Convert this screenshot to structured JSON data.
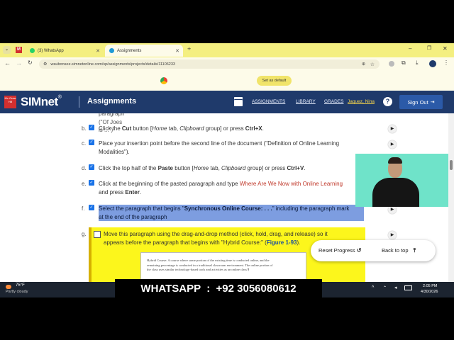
{
  "browser": {
    "tabs": [
      {
        "label": "(3) WhatsApp",
        "color": "#25d366"
      },
      {
        "label": "Assignments",
        "color": "#1f9ad6"
      }
    ],
    "new_tab": "+",
    "url": "waubonsee.simnetonline.com/sp/assignments/projects/details/11106233",
    "set_default": "Set as default"
  },
  "header": {
    "logo_brand": "Mc Graw Hill",
    "logo": "SIMnet",
    "reg": "®",
    "title": "Assignments",
    "nav": [
      "ASSIGNMENTS",
      "LIBRARY",
      "GRADES"
    ],
    "user": "Jaquez, Nina",
    "help": "?",
    "sign_out": "Sign Out"
  },
  "steps": {
    "partial": "paragraph (\"Of Joes is ...\")",
    "b": {
      "letter": "b.",
      "pre": "Click the ",
      "kw": "Cut",
      "mid": " button [",
      "em1": "Home",
      "mid2": " tab, ",
      "em2": "Clipboard",
      "post": " group] or press ",
      "key": "Ctrl+X",
      "end": "."
    },
    "c": {
      "letter": "c.",
      "line1": "Place your insertion point before the second line of the document (\"Definition of Online Learning",
      "line2": "Modalities\")."
    },
    "d": {
      "letter": "d.",
      "pre": "Click the top half of the ",
      "kw": "Paste",
      "mid": " button [",
      "em1": "Home",
      "mid2": " tab, ",
      "em2": "Clipboard",
      "post": " group] or press ",
      "key": "Ctrl+V",
      "end": "."
    },
    "e": {
      "letter": "e.",
      "line1_pre": "Click at the beginning of the pasted paragraph and type ",
      "line1_red": "Where Are We Now with Online Learning",
      "line2_pre": "and press ",
      "key": "Enter",
      "end": "."
    },
    "f": {
      "letter": "f.",
      "line1_pre": "Select the paragraph that begins \"",
      "kw": "Synchronous Online Course: . . .",
      "line1_post": "\" including the paragraph mark",
      "line2": "at the end of the paragraph"
    },
    "g": {
      "letter": "g.",
      "line1": "Move this paragraph using the drag-and-drop method (click, hold, drag, and release) so it",
      "line2_pre": "appears before the paragraph that begins with \"Hybrid Course:\" (",
      "fig": "Figure 1-93",
      "line2_post": ")."
    }
  },
  "figure_snippet": [
    "Hybrid Course: A course where some portion of the existing time is conducted online, and the",
    "remaining percentage is conducted in a traditional classroom environment. The online portion of",
    "the class uses similar technology-based tools and activities as an online class.¶"
  ],
  "floating_panel": {
    "reset": "Reset Progress",
    "back_to_top": "Back to top"
  },
  "taskbar": {
    "temp": "75°F",
    "weather": "Partly cloudy",
    "banner": "WHATSAPP  :  +92 3056080612",
    "time": "2:05 PM",
    "date": "4/30/2026"
  }
}
